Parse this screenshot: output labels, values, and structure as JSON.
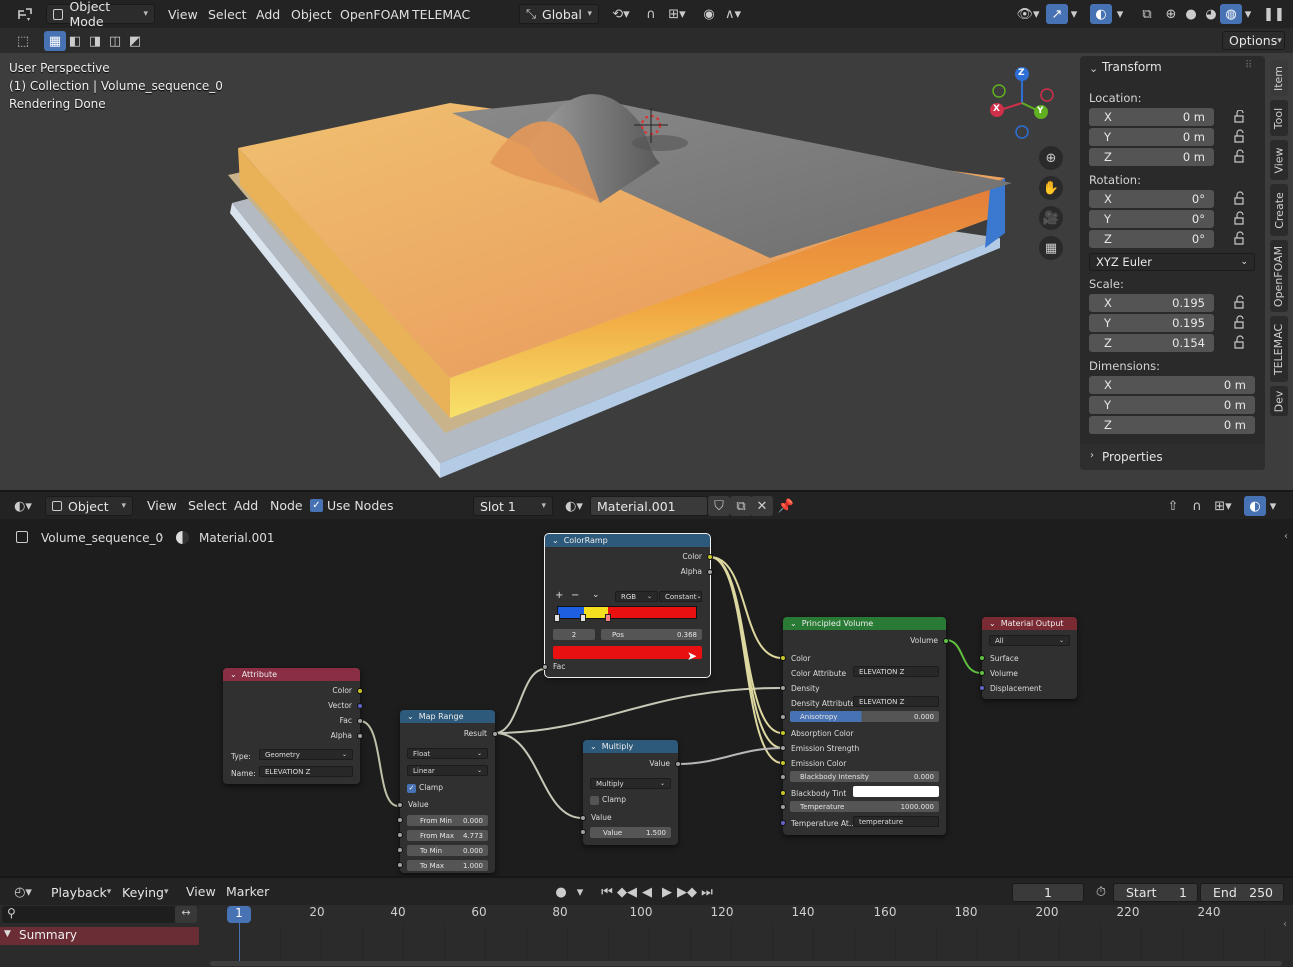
{
  "top_header": {
    "mode": "Object Mode",
    "menus": [
      "View",
      "Select",
      "Add",
      "Object",
      "OpenFOAM",
      "TELEMAC"
    ],
    "orientation": "Global",
    "options_label": "Options"
  },
  "viewport": {
    "info_line1": "User Perspective",
    "info_line2": "(1) Collection | Volume_sequence_0",
    "info_line3": "Rendering Done",
    "gizmo": {
      "x": "X",
      "y": "Y",
      "z": "Z"
    }
  },
  "npanel": {
    "transform_title": "Transform",
    "location_label": "Location:",
    "location": [
      {
        "axis": "X",
        "value": "0 m"
      },
      {
        "axis": "Y",
        "value": "0 m"
      },
      {
        "axis": "Z",
        "value": "0 m"
      }
    ],
    "rotation_label": "Rotation:",
    "rotation": [
      {
        "axis": "X",
        "value": "0°"
      },
      {
        "axis": "Y",
        "value": "0°"
      },
      {
        "axis": "Z",
        "value": "0°"
      }
    ],
    "rotation_mode": "XYZ Euler",
    "scale_label": "Scale:",
    "scale": [
      {
        "axis": "X",
        "value": "0.195"
      },
      {
        "axis": "Y",
        "value": "0.195"
      },
      {
        "axis": "Z",
        "value": "0.154"
      }
    ],
    "dimensions_label": "Dimensions:",
    "dimensions": [
      {
        "axis": "X",
        "value": "0 m"
      },
      {
        "axis": "Y",
        "value": "0 m"
      },
      {
        "axis": "Z",
        "value": "0 m"
      }
    ],
    "properties_title": "Properties",
    "tabs": [
      "Item",
      "Tool",
      "View",
      "Create",
      "OpenFOAM",
      "TELEMAC",
      "Dev"
    ]
  },
  "node_header": {
    "editor_type": "Object",
    "menus": [
      "View",
      "Select",
      "Add",
      "Node"
    ],
    "use_nodes_label": "Use Nodes",
    "slot": "Slot 1",
    "material": "Material.001"
  },
  "breadcrumb": {
    "object": "Volume_sequence_0",
    "material": "Material.001"
  },
  "nodes": {
    "attribute": {
      "title": "Attribute",
      "outputs": [
        "Color",
        "Vector",
        "Fac",
        "Alpha"
      ],
      "type_label": "Type:",
      "type_value": "Geometry",
      "name_label": "Name:",
      "name_value": "ELEVATION Z"
    },
    "map_range": {
      "title": "Map Range",
      "output": "Result",
      "data_type": "Float",
      "interpolation": "Linear",
      "clamp_label": "Clamp",
      "input_label": "Value",
      "fields": [
        {
          "label": "From Min",
          "value": "0.000"
        },
        {
          "label": "From Max",
          "value": "4.773"
        },
        {
          "label": "To Min",
          "value": "0.000"
        },
        {
          "label": "To Max",
          "value": "1.000"
        }
      ]
    },
    "color_ramp": {
      "title": "ColorRamp",
      "outputs": [
        "Color",
        "Alpha"
      ],
      "color_mode": "RGB",
      "interpolation": "Constant",
      "index": "2",
      "pos_label": "Pos",
      "pos_value": "0.368",
      "input_label": "Fac"
    },
    "multiply": {
      "title": "Multiply",
      "output": "Value",
      "operation": "Multiply",
      "clamp_label": "Clamp",
      "input_label": "Value",
      "value_label": "Value",
      "value": "1.500"
    },
    "principled_volume": {
      "title": "Principled Volume",
      "output": "Volume",
      "color_label": "Color",
      "color_attr_label": "Color Attribute",
      "color_attr_value": "ELEVATION Z",
      "density_label": "Density",
      "density_attr_label": "Density Attribute",
      "density_attr_value": "ELEVATION Z",
      "anisotropy_label": "Anisotropy",
      "anisotropy_value": "0.000",
      "absorption_label": "Absorption Color",
      "emission_strength_label": "Emission Strength",
      "emission_color_label": "Emission Color",
      "blackbody_label": "Blackbody Intensity",
      "blackbody_value": "0.000",
      "blackbody_tint_label": "Blackbody Tint",
      "temperature_label": "Temperature",
      "temperature_value": "1000.000",
      "temp_attr_label": "Temperature At..",
      "temp_attr_value": "temperature"
    },
    "material_output": {
      "title": "Material Output",
      "target": "All",
      "inputs": [
        "Surface",
        "Volume",
        "Displacement"
      ]
    }
  },
  "timeline": {
    "menus": [
      "Playback",
      "Keying",
      "View",
      "Marker"
    ],
    "current_frame": "1",
    "start_label": "Start",
    "start": "1",
    "end_label": "End",
    "end": "250",
    "ticks": [
      "20",
      "40",
      "60",
      "80",
      "100",
      "120",
      "140",
      "160",
      "180",
      "200",
      "220",
      "240"
    ],
    "playhead": "1",
    "summary": "Summary"
  }
}
